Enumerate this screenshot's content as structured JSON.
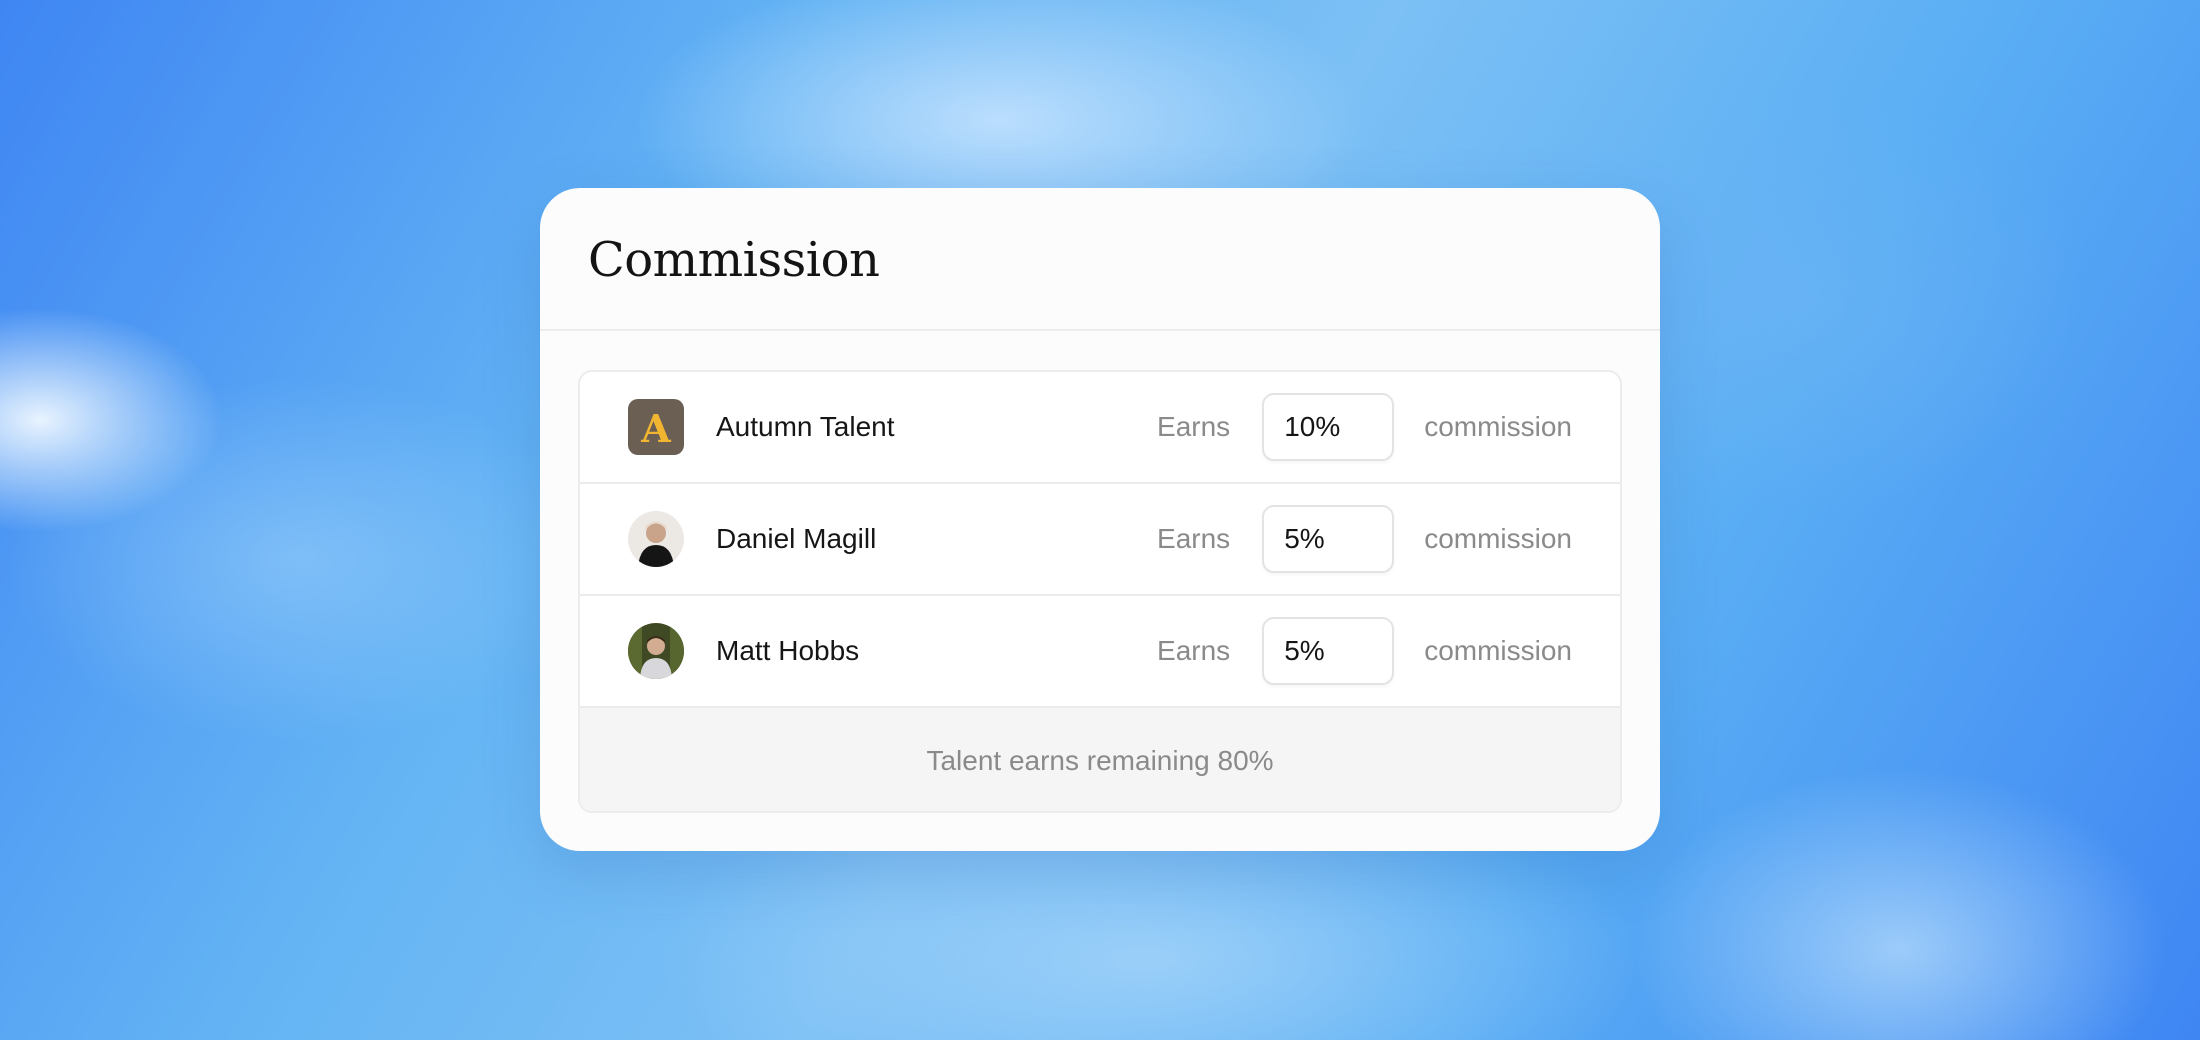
{
  "card": {
    "title": "Commission",
    "rows": [
      {
        "name": "Autumn Talent",
        "earns_label": "Earns",
        "value": "10%",
        "suffix": "commission",
        "avatar": "autumn-talent-logo"
      },
      {
        "name": "Daniel Magill",
        "earns_label": "Earns",
        "value": "5%",
        "suffix": "commission",
        "avatar": "person-photo"
      },
      {
        "name": "Matt Hobbs",
        "earns_label": "Earns",
        "value": "5%",
        "suffix": "commission",
        "avatar": "person-photo"
      }
    ],
    "footer": "Talent earns remaining 80%"
  },
  "logo_letter": "A",
  "colors": {
    "logo_bg": "#6b5f54",
    "logo_letter": "#f2b531"
  }
}
